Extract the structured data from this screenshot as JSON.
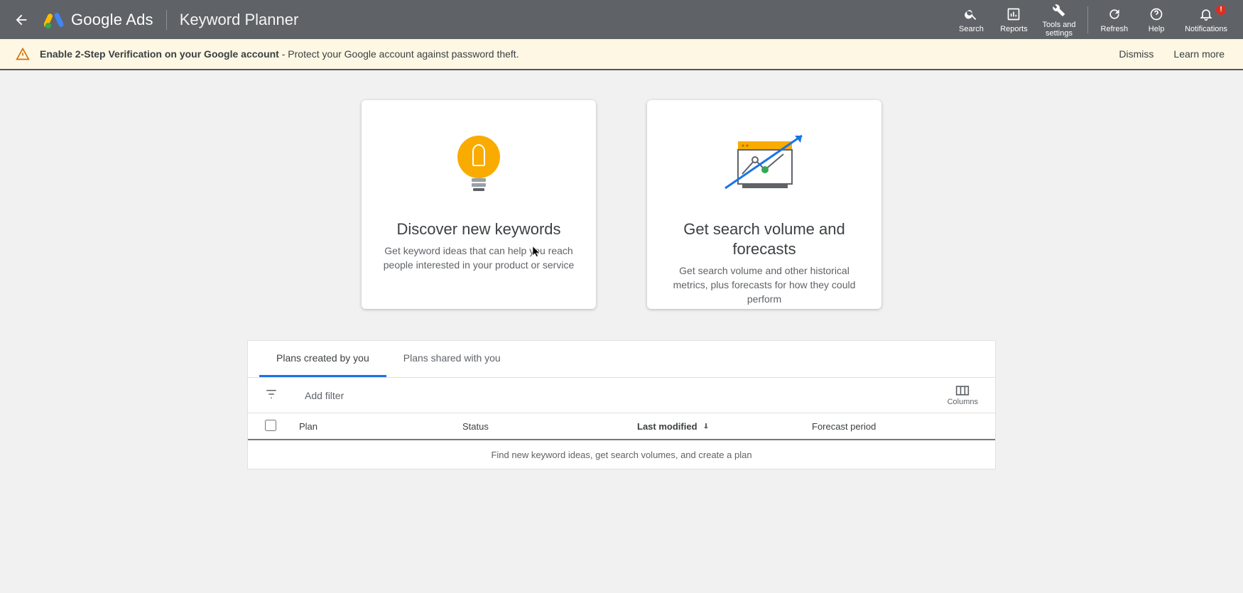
{
  "topbar": {
    "brand": "Google Ads",
    "page": "Keyword Planner",
    "tools": {
      "search": "Search",
      "reports": "Reports",
      "tools": "Tools and\nsettings",
      "refresh": "Refresh",
      "help": "Help",
      "notifications": "Notifications",
      "badge": "!"
    }
  },
  "notice": {
    "bold": "Enable 2-Step Verification on your Google account",
    "rest": " - Protect your Google account against password theft.",
    "dismiss": "Dismiss",
    "learn": "Learn more"
  },
  "cards": {
    "left": {
      "title": "Discover new keywords",
      "sub": "Get keyword ideas that can help you reach people interested in your product or service"
    },
    "right": {
      "title": "Get search volume and forecasts",
      "sub": "Get search volume and other historical metrics, plus forecasts for how they could perform"
    }
  },
  "tabs": {
    "mine": "Plans created by you",
    "shared": "Plans shared with you"
  },
  "filter": {
    "add": "Add filter",
    "columns": "Columns"
  },
  "head": {
    "plan": "Plan",
    "status": "Status",
    "modified": "Last modified",
    "period": "Forecast period"
  },
  "empty": "Find new keyword ideas, get search volumes, and create a plan"
}
